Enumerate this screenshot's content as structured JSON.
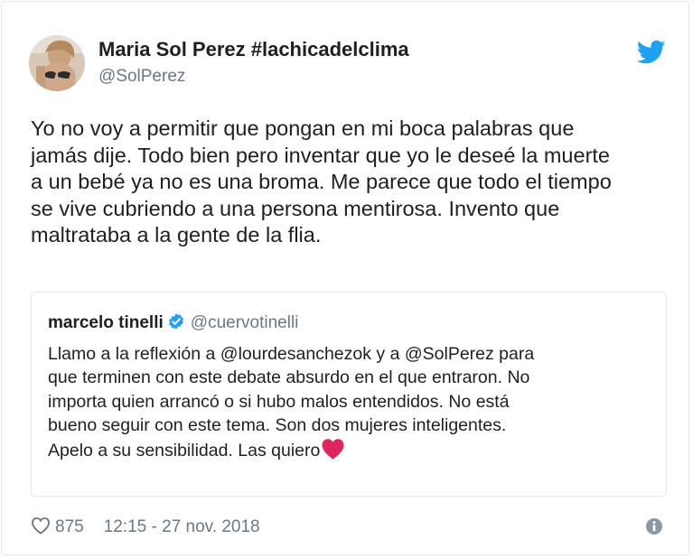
{
  "tweet": {
    "author_name": "Maria Sol Perez #lachicadelclima",
    "author_handle": "@SolPerez",
    "text": "Yo no voy a permitir que pongan en mi boca palabras que\njamás dije. Todo bien pero inventar que yo le deseé la muerte\na un bebé ya no es una broma. Me parece que todo el tiempo\nse vive cubriendo a una persona mentirosa. Invento que\nmaltrataba a la gente de la flia.",
    "likes": "875",
    "timestamp": "12:15 - 27 nov. 2018",
    "icons": {
      "brand": "twitter-bird-icon",
      "like": "heart-outline-icon",
      "info": "info-icon"
    }
  },
  "quoted_tweet": {
    "author_name": "marcelo tinelli",
    "author_handle": "@cuervotinelli",
    "text": "Llamo a la reflexión a @lourdesanchezok y a @SolPerez para\nque terminen con este debate absurdo en el que entraron. No\nimporta quien arrancó o si hubo malos entendidos. No está\nbueno seguir con este tema. Son dos mujeres inteligentes.\nApelo a su sensibilidad. Las quiero",
    "icons": {
      "verified": "verified-badge-icon",
      "emoji": "red-heart-emoji"
    }
  },
  "colors": {
    "twitter_blue": "#1da1f2",
    "text_primary": "#1c2022",
    "text_secondary": "#697882",
    "border": "#e1e8ed",
    "heart_red": "#e0245e"
  }
}
